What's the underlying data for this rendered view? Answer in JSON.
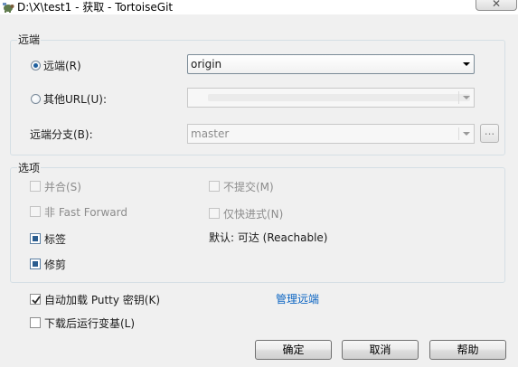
{
  "window": {
    "title": "D:\\X\\test1 - 获取 - TortoiseGit",
    "close_label": "✕"
  },
  "remote_group": {
    "label": "远端",
    "remote_radio_label": "远端(R)",
    "remote_value": "origin",
    "other_url_label": "其他URL(U):",
    "other_url_value": "",
    "remote_branch_label": "远端分支(B):",
    "remote_branch_value": "master",
    "browse_label": "..."
  },
  "options_group": {
    "label": "选项",
    "merge_label": "并合(S)",
    "no_commit_label": "不提交(M)",
    "no_ff_label": "非 Fast Forward",
    "ff_only_label": "仅快进式(N)",
    "tags_label": "标签",
    "default_text": "默认: 可达 (Reachable)",
    "prune_label": "修剪"
  },
  "bottom": {
    "autoload_putty_label": "自动加载 Putty 密钥(K)",
    "manage_remotes_label": "管理远端",
    "rebase_after_label": "下载后运行变基(L)"
  },
  "buttons": {
    "ok": "确定",
    "cancel": "取消",
    "help": "帮助"
  },
  "colors": {
    "link": "#0a64c2",
    "accent": "#1e5f9e"
  }
}
